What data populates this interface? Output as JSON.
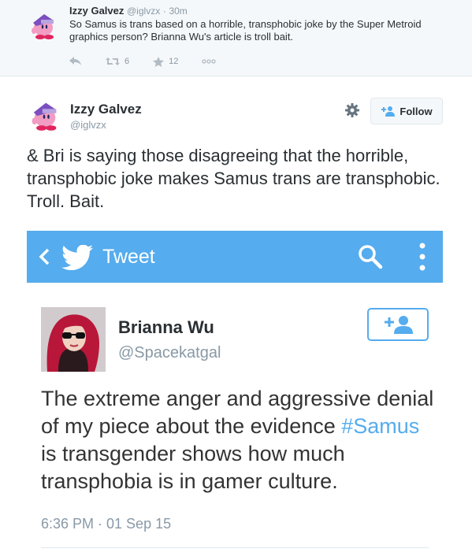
{
  "parent_tweet": {
    "name": "Izzy Galvez",
    "handle": "@iglvzx",
    "separator": "·",
    "time": "30m",
    "text": "So Samus is trans based on a horrible, transphobic joke by the Super Metroid graphics person? Brianna Wu's article is troll bait.",
    "actions": {
      "reply_icon": "reply-icon",
      "retweet_icon": "retweet-icon",
      "retweet_count": "6",
      "favorite_icon": "star-icon",
      "favorite_count": "12",
      "more_icon": "more-dots-icon"
    }
  },
  "main_tweet": {
    "name": "Izzy Galvez",
    "handle": "@iglvzx",
    "settings_icon": "gear-icon",
    "follow_label": "Follow",
    "text": "& Bri is saying those disagreeing that the horrible, transphobic joke makes Samus trans are transphobic. Troll. Bait."
  },
  "embedded_screenshot": {
    "header": {
      "back_icon": "chevron-left-icon",
      "logo_icon": "twitter-bird-icon",
      "title": "Tweet",
      "search_icon": "search-icon",
      "more_icon": "vertical-dots-icon",
      "bar_color": "#55acee"
    },
    "tweet": {
      "name": "Brianna Wu",
      "handle": "@Spacekatgal",
      "follow_icon": "add-user-icon",
      "text_before": "The extreme anger and aggressive denial of my piece about the evidence ",
      "hashtag": "#Samus",
      "text_after": " is transgender shows how much transphobia is in gamer culture.",
      "timestamp": "6:36 PM · 01 Sep 15"
    }
  },
  "colors": {
    "accent": "#55acee",
    "muted_text": "#8899a6",
    "primary_text": "#292f33"
  }
}
